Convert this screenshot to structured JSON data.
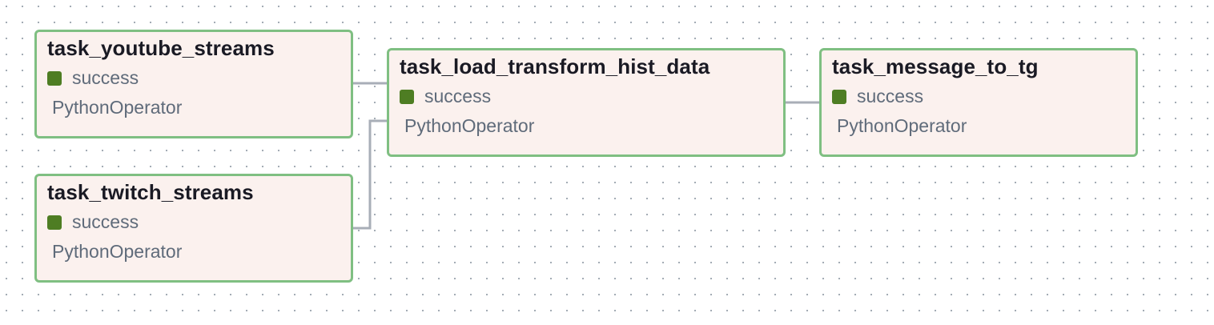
{
  "graph": {
    "nodes": [
      {
        "id": "task_youtube_streams",
        "title": "task_youtube_streams",
        "status": "success",
        "operator": "PythonOperator"
      },
      {
        "id": "task_twitch_streams",
        "title": "task_twitch_streams",
        "status": "success",
        "operator": "PythonOperator"
      },
      {
        "id": "task_load_transform_hist_data",
        "title": "task_load_transform_hist_data",
        "status": "success",
        "operator": "PythonOperator"
      },
      {
        "id": "task_message_to_tg",
        "title": "task_message_to_tg",
        "status": "success",
        "operator": "PythonOperator"
      }
    ],
    "edges": [
      {
        "from": "task_youtube_streams",
        "to": "task_load_transform_hist_data"
      },
      {
        "from": "task_twitch_streams",
        "to": "task_load_transform_hist_data"
      },
      {
        "from": "task_load_transform_hist_data",
        "to": "task_message_to_tg"
      }
    ],
    "colors": {
      "node_border": "#7fbf82",
      "node_background": "#fbf1ee",
      "success_status": "#4e7d23",
      "edge": "#a8aeb7"
    }
  }
}
